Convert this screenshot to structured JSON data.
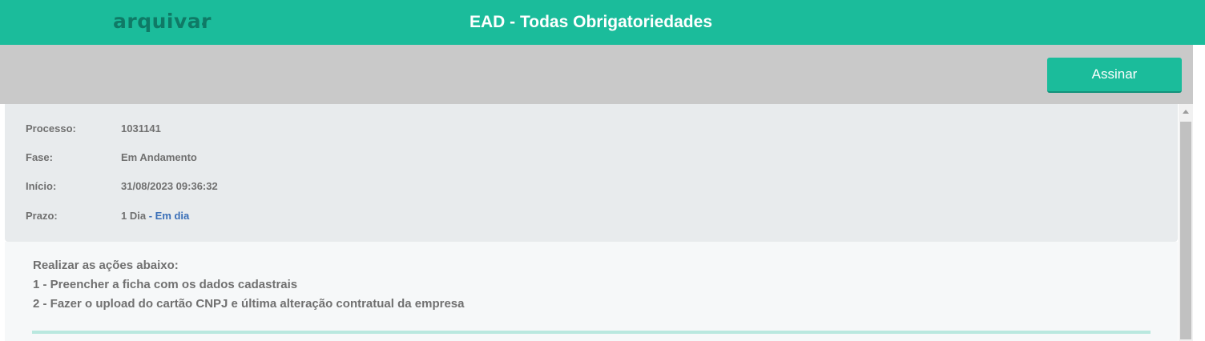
{
  "header": {
    "logo_text": "arquivar",
    "title": "EAD - Todas Obrigatoriedades"
  },
  "toolbar": {
    "sign_label": "Assinar"
  },
  "process": {
    "fields": [
      {
        "label": "Processo:",
        "value": "1031141"
      },
      {
        "label": "Fase:",
        "value": "Em Andamento"
      },
      {
        "label": "Início:",
        "value": "31/08/2023 09:36:32"
      },
      {
        "label": "Prazo:",
        "value": "1 Dia",
        "status": "- Em dia"
      }
    ]
  },
  "instructions": {
    "lines": [
      "Realizar as ações abaixo:",
      "1 - Preencher a ficha com os dados cadastrais",
      "2 - Fazer o upload do cartão CNPJ e última alteração contratual da empresa"
    ]
  },
  "colors": {
    "brand": "#1bbc9b",
    "status_link": "#3a6fb8"
  }
}
